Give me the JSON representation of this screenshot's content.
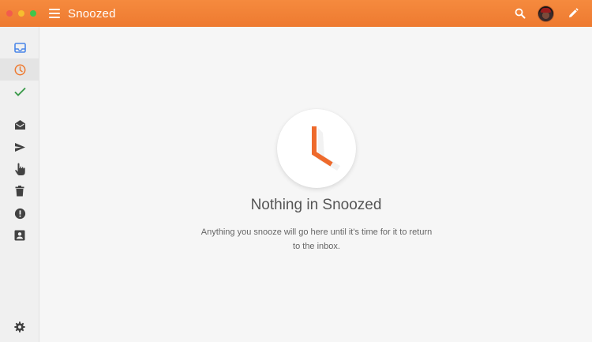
{
  "window": {
    "title": "Snoozed",
    "controls": [
      "close",
      "minimize",
      "maximize"
    ]
  },
  "toolbar": {
    "menu_icon": "hamburger-menu-icon",
    "search_icon": "search-icon",
    "avatar": "user-avatar",
    "compose_icon": "pencil-icon"
  },
  "sidebar": {
    "items": [
      {
        "id": "inbox",
        "icon": "inbox-icon",
        "color": "#4a86e8",
        "active": false
      },
      {
        "id": "snoozed",
        "icon": "clock-icon",
        "color": "#ee7a30",
        "active": true
      },
      {
        "id": "done",
        "icon": "checkmark-icon",
        "color": "#3a9a4a",
        "active": false
      },
      {
        "id": "drafts",
        "icon": "open-envelope-icon",
        "color": "#424242",
        "active": false
      },
      {
        "id": "sent",
        "icon": "send-icon",
        "color": "#424242",
        "active": false
      },
      {
        "id": "reminders",
        "icon": "pointing-hand-icon",
        "color": "#424242",
        "active": false
      },
      {
        "id": "trash",
        "icon": "trash-icon",
        "color": "#424242",
        "active": false
      },
      {
        "id": "spam",
        "icon": "exclamation-icon",
        "color": "#424242",
        "active": false
      },
      {
        "id": "contacts",
        "icon": "contact-card-icon",
        "color": "#424242",
        "active": false
      }
    ],
    "settings_icon": "gear-icon"
  },
  "main": {
    "empty_state": {
      "icon": "clock-icon",
      "title": "Nothing in Snoozed",
      "description": "Anything you snooze will go here until it's time for it to return to the inbox."
    }
  },
  "colors": {
    "accent": "#ee7a30",
    "toolbar": "#f28435",
    "background": "#f6f6f6"
  }
}
